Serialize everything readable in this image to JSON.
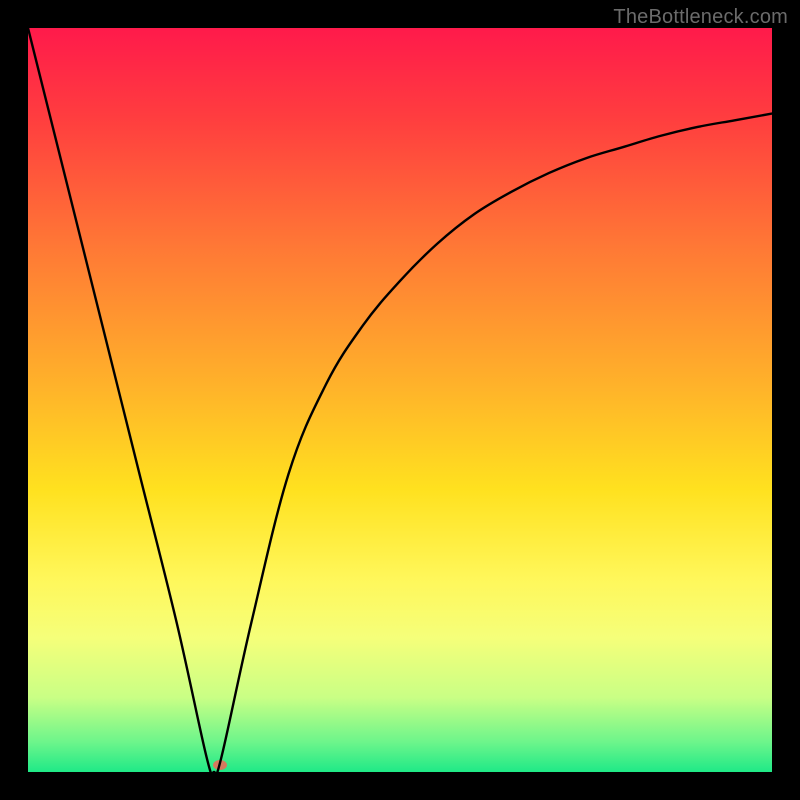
{
  "watermark": "TheBottleneck.com",
  "chart_data": {
    "type": "line",
    "title": "",
    "xlabel": "",
    "ylabel": "",
    "xlim": [
      0,
      100
    ],
    "ylim": [
      0,
      100
    ],
    "x": [
      0,
      5,
      10,
      15,
      20,
      24,
      25,
      26,
      30,
      35,
      40,
      45,
      50,
      55,
      60,
      65,
      70,
      75,
      80,
      85,
      90,
      95,
      100
    ],
    "values": [
      100,
      80,
      60,
      40,
      20,
      2,
      0,
      2,
      20,
      40,
      52,
      60,
      66,
      71,
      75,
      78,
      80.5,
      82.5,
      84,
      85.5,
      86.7,
      87.6,
      88.5
    ],
    "minimum_point": {
      "x": 25,
      "y": 0
    },
    "dot": {
      "x": 25.8,
      "y": 1.0,
      "color": "#d67a5e"
    },
    "gradient_stops": [
      {
        "pct": 0,
        "color": "#ff1a4b"
      },
      {
        "pct": 12,
        "color": "#ff3d3f"
      },
      {
        "pct": 30,
        "color": "#ff7a35"
      },
      {
        "pct": 48,
        "color": "#ffb22a"
      },
      {
        "pct": 62,
        "color": "#ffe11f"
      },
      {
        "pct": 74,
        "color": "#fff75a"
      },
      {
        "pct": 82,
        "color": "#f5ff7a"
      },
      {
        "pct": 90,
        "color": "#c9ff85"
      },
      {
        "pct": 96,
        "color": "#6cf58b"
      },
      {
        "pct": 100,
        "color": "#1fe987"
      }
    ]
  }
}
